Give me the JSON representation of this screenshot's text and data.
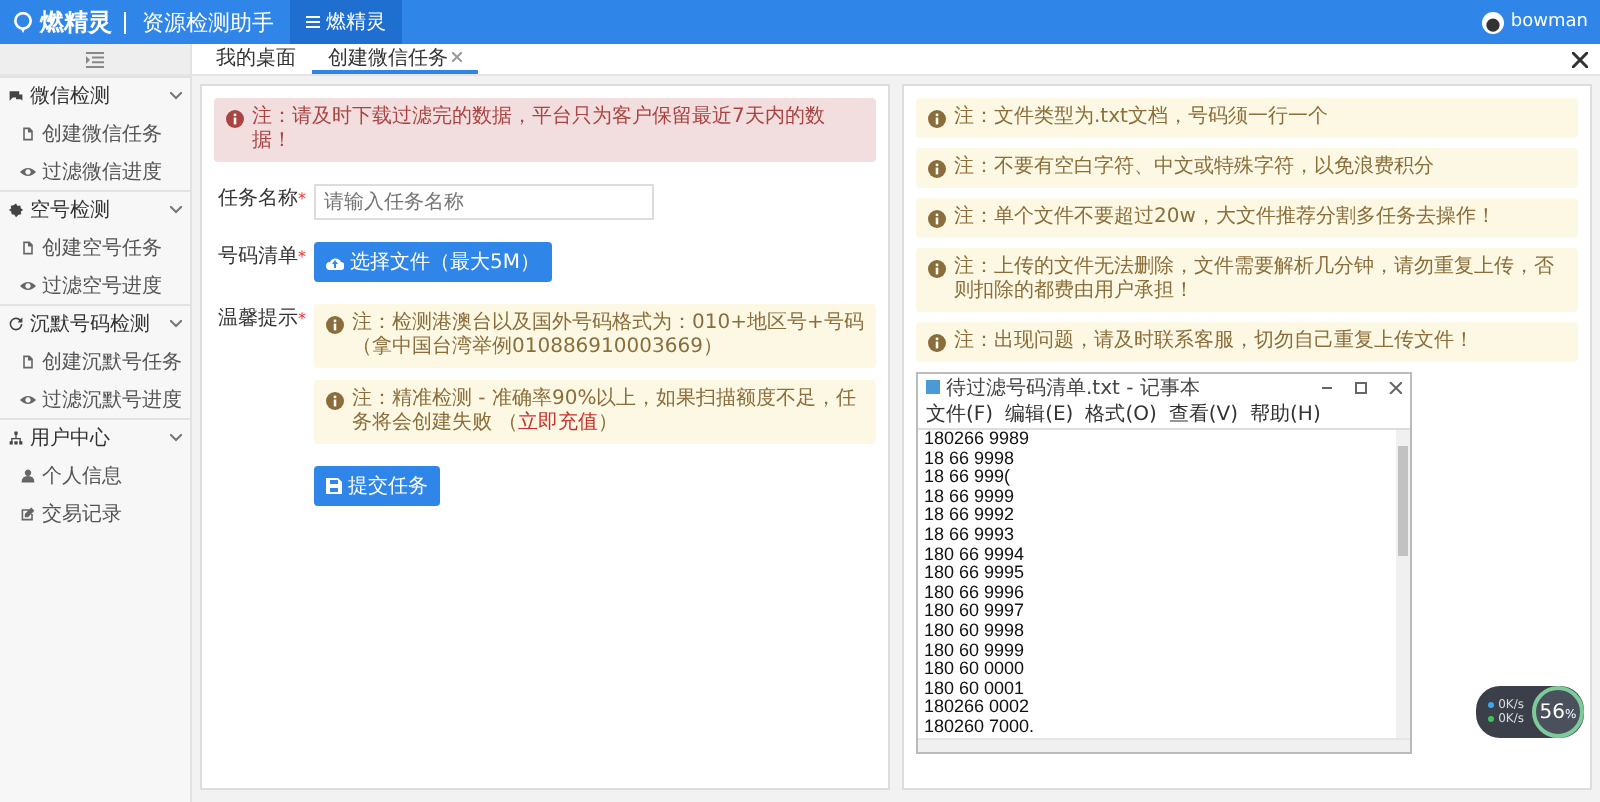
{
  "header": {
    "logo": "燃精灵",
    "subtitle": "资源检测助手",
    "menu_button": "燃精灵",
    "user": "bowman"
  },
  "sidebar": {
    "groups": [
      {
        "label": "微信检测",
        "expanded": true,
        "items": [
          {
            "label": "创建微信任务",
            "selected": false
          },
          {
            "label": "过滤微信进度",
            "selected": false
          }
        ]
      },
      {
        "label": "空号检测",
        "expanded": true,
        "items": [
          {
            "label": "创建空号任务",
            "selected": false
          },
          {
            "label": "过滤空号进度",
            "selected": false
          }
        ]
      },
      {
        "label": "沉默号码检测",
        "expanded": true,
        "items": [
          {
            "label": "创建沉默号任务",
            "selected": false
          },
          {
            "label": "过滤沉默号进度",
            "selected": false
          }
        ]
      },
      {
        "label": "用户中心",
        "expanded": true,
        "items": [
          {
            "label": "个人信息",
            "selected": false
          },
          {
            "label": "交易记录",
            "selected": false
          }
        ]
      }
    ]
  },
  "tabs": [
    {
      "label": "我的桌面",
      "selected": false,
      "closable": false
    },
    {
      "label": "创建微信任务",
      "selected": true,
      "closable": true
    }
  ],
  "form": {
    "alert": "注：请及时下载过滤完的数据，平台只为客户保留最近7天内的数据！",
    "required_mark": "*",
    "name_label": "任务名称",
    "name_placeholder": "请输入任务名称",
    "file_label": "号码清单",
    "file_button": "选择文件（最大5M）",
    "tips_label": "温馨提示",
    "tips": [
      {
        "text": "注：检测港澳台以及国外号码格式为：010+地区号+号码（拿中国台湾举例010886910003669）"
      },
      {
        "text": "注：精准检测 - 准确率90%以上，如果扫描额度不足，任务将会创建失败 （",
        "link": "立即充值",
        "text_after": "）"
      }
    ],
    "submit": "提交任务"
  },
  "notes": [
    "注：文件类型为.txt文档，号码须一行一个",
    "注：不要有空白字符、中文或特殊字符，以免浪费积分",
    "注：单个文件不要超过20w，大文件推荐分割多任务去操作！",
    "注：上传的文件无法删除，文件需要解析几分钟，请勿重复上传，否则扣除的都费由用户承担！",
    "注：出现问题，请及时联系客服，切勿自己重复上传文件！"
  ],
  "notepad": {
    "title": "待过滤号码清单.txt - 记事本",
    "menus": [
      "文件(F)",
      "编辑(E)",
      "格式(O)",
      "查看(V)",
      "帮助(H)"
    ],
    "lines": [
      "180266 9989",
      "18 66 9998",
      "18 66 999(",
      "18 66 9999",
      "18 66 9992",
      "18 66 9993",
      "180 66 9994",
      "180 66 9995",
      "180 66 9996",
      "180 60 9997",
      "180 60 9998",
      "180 60 9999",
      "180 60 0000",
      "180 60 0001",
      "180266 0002",
      "180260 7000."
    ]
  },
  "speed": {
    "percent": "56",
    "unit": "%",
    "upload": "0K/s",
    "download": "0K/s"
  }
}
